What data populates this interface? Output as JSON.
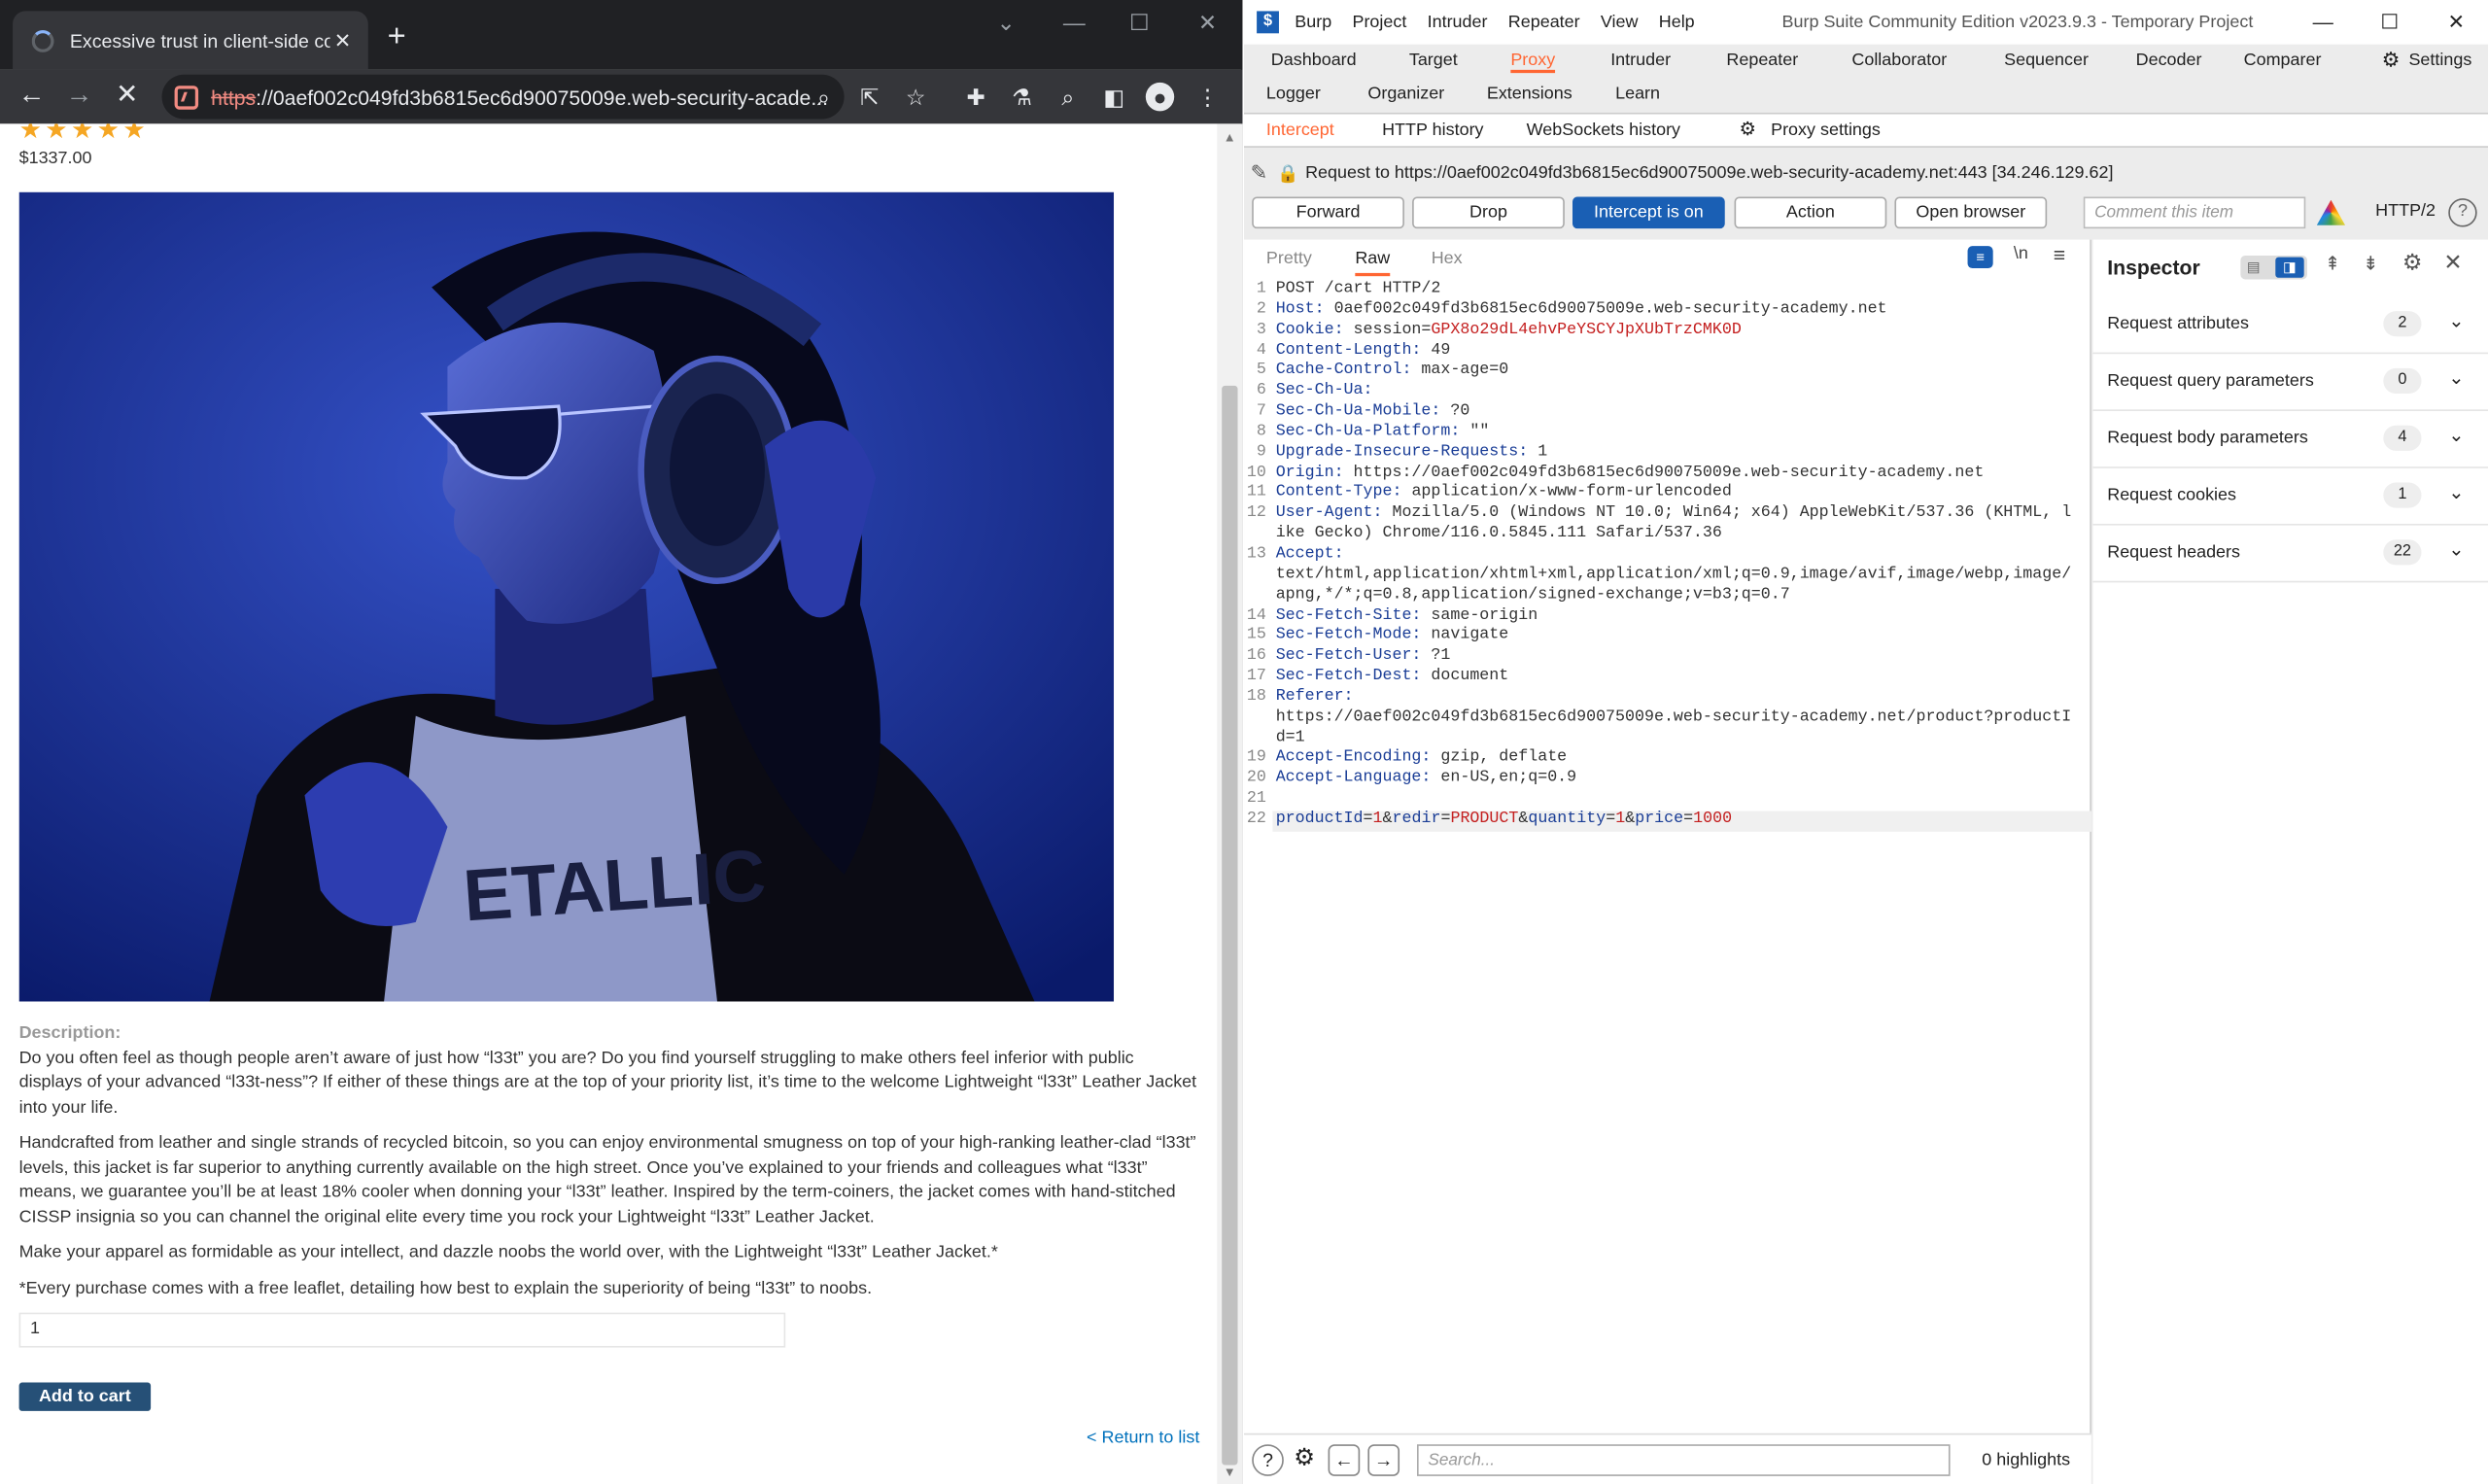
{
  "browser": {
    "tab_title": "Excessive trust in client-side cont",
    "url_scheme": "https",
    "url_rest": "://0aef002c049fd3b6815ec6d90075009e.web-security-acade...",
    "icons": [
      "search-icon",
      "share-icon",
      "star-icon",
      "extensions-icon",
      "labs-icon",
      "zoom-icon",
      "sidebar-icon",
      "profile-icon",
      "menu-icon"
    ]
  },
  "product": {
    "stars": "★★★★★",
    "price": "$1337.00",
    "description_heading": "Description:",
    "paragraphs": [
      "Do you often feel as though people aren’t aware of just how “l33t” you are? Do you find yourself struggling to make others feel inferior with public displays of your advanced “l33t-ness”? If either of these things are at the top of your priority list, it’s time to the welcome Lightweight “l33t” Leather Jacket into your life.",
      "Handcrafted from leather and single strands of recycled bitcoin, so you can enjoy environmental smugness on top of your high-ranking leather-clad “l33t” levels, this jacket is far superior to anything currently available on the high street. Once you’ve explained to your friends and colleagues what “l33t” means, we guarantee you’ll be at least 18% cooler when donning your “l33t” leather. Inspired by the term-coiners, the jacket comes with hand-stitched CISSP insignia so you can channel the original elite every time you rock your Lightweight “l33t” Leather Jacket.",
      "Make your apparel as formidable as your intellect, and dazzle noobs the world over, with the Lightweight “l33t” Leather Jacket.*",
      "*Every purchase comes with a free leaflet, detailing how best to explain the superiority of being “l33t” to noobs."
    ],
    "quantity": "1",
    "add_to_cart": "Add to cart",
    "return_link": "< Return to list"
  },
  "burp": {
    "menu": [
      "Burp",
      "Project",
      "Intruder",
      "Repeater",
      "View",
      "Help"
    ],
    "app_title": "Burp Suite Community Edition v2023.9.3 - Temporary Project",
    "tabs_row1": [
      "Dashboard",
      "Target",
      "Proxy",
      "Intruder",
      "Repeater",
      "Collaborator",
      "Sequencer",
      "Decoder",
      "Comparer",
      "Settings"
    ],
    "tabs_row2": [
      "Logger",
      "Organizer",
      "Extensions",
      "Learn"
    ],
    "proxy_tabs": [
      "Intercept",
      "HTTP history",
      "WebSockets history",
      "Proxy settings"
    ],
    "request_to": "Request to https://0aef002c049fd3b6815ec6d90075009e.web-security-academy.net:443  [34.246.129.62]",
    "buttons": {
      "forward": "Forward",
      "drop": "Drop",
      "intercept": "Intercept is on",
      "action": "Action",
      "open_browser": "Open browser"
    },
    "comment_placeholder": "Comment this item",
    "http_version": "HTTP/2",
    "editor_tabs": [
      "Pretty",
      "Raw",
      "Hex"
    ],
    "request_lines": [
      {
        "n": "1",
        "k": "",
        "v": "POST /cart HTTP/2"
      },
      {
        "n": "2",
        "k": "Host:",
        "v": " 0aef002c049fd3b6815ec6d90075009e.web-security-academy.net"
      },
      {
        "n": "3",
        "k": "Cookie:",
        "v": " session=",
        "c": "GPX8o29dL4ehvPeYSCYJpXUbTrzCMK0D"
      },
      {
        "n": "4",
        "k": "Content-Length:",
        "v": " 49"
      },
      {
        "n": "5",
        "k": "Cache-Control:",
        "v": " max-age=0"
      },
      {
        "n": "6",
        "k": "Sec-Ch-Ua:",
        "v": ""
      },
      {
        "n": "7",
        "k": "Sec-Ch-Ua-Mobile:",
        "v": " ?0"
      },
      {
        "n": "8",
        "k": "Sec-Ch-Ua-Platform:",
        "v": " \"\""
      },
      {
        "n": "9",
        "k": "Upgrade-Insecure-Requests:",
        "v": " 1"
      },
      {
        "n": "10",
        "k": "Origin:",
        "v": " https://0aef002c049fd3b6815ec6d90075009e.web-security-academy.net"
      },
      {
        "n": "11",
        "k": "Content-Type:",
        "v": " application/x-www-form-urlencoded"
      },
      {
        "n": "12",
        "k": "User-Agent:",
        "v": " Mozilla/5.0 (Windows NT 10.0; Win64; x64) AppleWebKit/537.36 (KHTML, like Gecko) Chrome/116.0.5845.111 Safari/537.36"
      },
      {
        "n": "13",
        "k": "Accept:",
        "v": "\ntext/html,application/xhtml+xml,application/xml;q=0.9,image/avif,image/webp,image/apng,*/*;q=0.8,application/signed-exchange;v=b3;q=0.7"
      },
      {
        "n": "14",
        "k": "Sec-Fetch-Site:",
        "v": " same-origin"
      },
      {
        "n": "15",
        "k": "Sec-Fetch-Mode:",
        "v": " navigate"
      },
      {
        "n": "16",
        "k": "Sec-Fetch-User:",
        "v": " ?1"
      },
      {
        "n": "17",
        "k": "Sec-Fetch-Dest:",
        "v": " document"
      },
      {
        "n": "18",
        "k": "Referer:",
        "v": "\nhttps://0aef002c049fd3b6815ec6d90075009e.web-security-academy.net/product?productId=1"
      },
      {
        "n": "19",
        "k": "Accept-Encoding:",
        "v": " gzip, deflate"
      },
      {
        "n": "20",
        "k": "Accept-Language:",
        "v": " en-US,en;q=0.9"
      },
      {
        "n": "21",
        "k": "",
        "v": ""
      }
    ],
    "body_line": {
      "n": "22",
      "parts": [
        [
          "k",
          "productId"
        ],
        [
          "p",
          "="
        ],
        [
          "c",
          "1"
        ],
        [
          "p",
          "&"
        ],
        [
          "k",
          "redir"
        ],
        [
          "p",
          "="
        ],
        [
          "c",
          "PRODUCT"
        ],
        [
          "p",
          "&"
        ],
        [
          "k",
          "quantity"
        ],
        [
          "p",
          "="
        ],
        [
          "c",
          "1"
        ],
        [
          "p",
          "&"
        ],
        [
          "k",
          "price"
        ],
        [
          "p",
          "="
        ],
        [
          "c",
          "1000"
        ]
      ]
    },
    "search_placeholder": "Search...",
    "highlights": "0 highlights",
    "inspector": {
      "title": "Inspector",
      "rows": [
        {
          "label": "Request attributes",
          "count": "2"
        },
        {
          "label": "Request query parameters",
          "count": "0"
        },
        {
          "label": "Request body parameters",
          "count": "4"
        },
        {
          "label": "Request cookies",
          "count": "1"
        },
        {
          "label": "Request headers",
          "count": "22"
        }
      ]
    },
    "accent": "#ff6633",
    "primary": "#1a5fb4"
  }
}
